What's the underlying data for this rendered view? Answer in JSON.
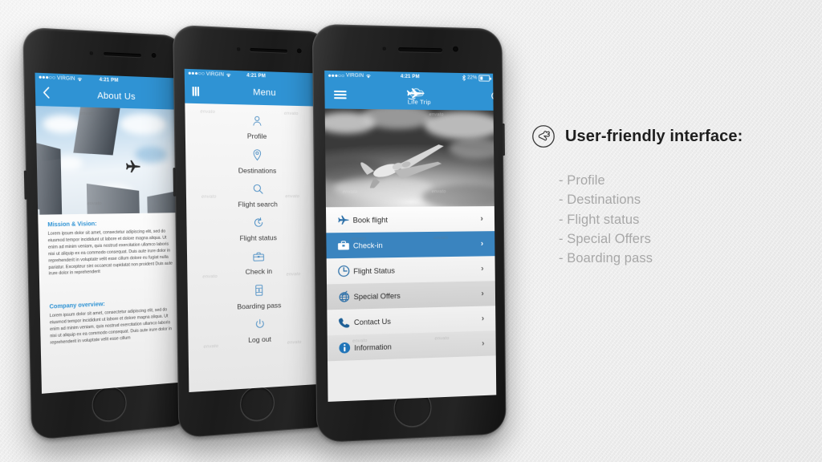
{
  "slide": {
    "background_color": "#efefef",
    "brand_blue": "#2f93d4",
    "selected_blue": "#3a84bf"
  },
  "panel": {
    "icon": "hand-ok-circle-icon",
    "heading": "User-friendly interface:",
    "features": [
      "- Profile",
      "- Destinations",
      "- Flight status",
      "- Special Offers",
      "- Boarding pass"
    ]
  },
  "watermark": "envato",
  "phones": {
    "left": {
      "name": "about-us-phone",
      "status": {
        "signal_dots": "●●●○○",
        "carrier": "VIRGIN",
        "wifi": "wifi-icon",
        "time": "4:21 PM"
      },
      "nav": {
        "back_icon": "chevron-left-icon",
        "title": "About Us"
      },
      "hero_alt": "skyscrapers-and-airplane-photo",
      "sections": [
        {
          "title": "Mission & Vision:",
          "body": "Lorem ipsum dolor sit amet, consectetur adipiscing elit, sed do eiusmod tempor incididunt ut labore et dolore magna aliqua. Ut enim ad minim veniam, quis nostrud exercitation ullamco laboris nisi ut aliquip ex ea commodo consequat. Duis aute irure dolor in reprehenderit in voluptate velit esse cillum dolore eu fugiat nulla pariatur. Excepteur sint occaecat cupidatat non proident  Duis aute irure dolor in reprehenderit"
        },
        {
          "title": "Company overview:",
          "body": "Lorem ipsum dolor sit amet, consectetur adipiscing elit, sed do eiusmod tempor incididunt ut labore et dolore magna aliqua. Ut enim ad minim veniam, quis nostrud exercitation ullamco laboris nisi ut aliquip ex ea commodo consequat. Duis aute irure dolor in reprehenderit in voluptate velit esse cillum"
        }
      ]
    },
    "middle": {
      "name": "menu-phone",
      "status": {
        "signal_dots": "●●●○○",
        "carrier": "VIRGIN",
        "wifi": "wifi-icon",
        "time": "4:21 PM"
      },
      "nav": {
        "menu_icon": "hamburger-icon",
        "title": "Menu"
      },
      "items": [
        {
          "label": "Profile",
          "icon": "user-icon"
        },
        {
          "label": "Destinations",
          "icon": "map-pin-icon"
        },
        {
          "label": "Flight search",
          "icon": "search-icon"
        },
        {
          "label": "Flight status",
          "icon": "refresh-clock-icon"
        },
        {
          "label": "Check in",
          "icon": "briefcase-icon"
        },
        {
          "label": "Boarding pass",
          "icon": "boarding-pass-icon"
        },
        {
          "label": "Log out",
          "icon": "power-icon"
        }
      ]
    },
    "right": {
      "name": "home-phone",
      "status": {
        "signal_dots": "●●●○○",
        "carrier": "VIRGIN",
        "wifi": "wifi-icon",
        "time": "4:21 PM",
        "bluetooth": "bluetooth-icon",
        "battery_percent": "22%"
      },
      "nav": {
        "menu_icon": "hamburger-icon",
        "logo_text": "Life Trip",
        "logo_icon": "plane-cloud-logo-icon",
        "search_icon": "search-icon"
      },
      "hero_alt": "airplane-above-clouds-photo",
      "list": [
        {
          "label": "Book flight",
          "icon": "plane-icon",
          "selected": false,
          "chevron": "›"
        },
        {
          "label": "Check-in",
          "icon": "briefcase-icon",
          "selected": true,
          "chevron": "›"
        },
        {
          "label": "Flight Status",
          "icon": "clock-icon",
          "selected": false,
          "chevron": "›"
        },
        {
          "label": "Special Offers",
          "icon": "globe-icon",
          "selected": false,
          "chevron": "›"
        },
        {
          "label": "Contact Us",
          "icon": "phone-icon",
          "selected": false,
          "chevron": "›"
        },
        {
          "label": "Information",
          "icon": "info-icon",
          "selected": false,
          "chevron": "›"
        }
      ]
    }
  }
}
